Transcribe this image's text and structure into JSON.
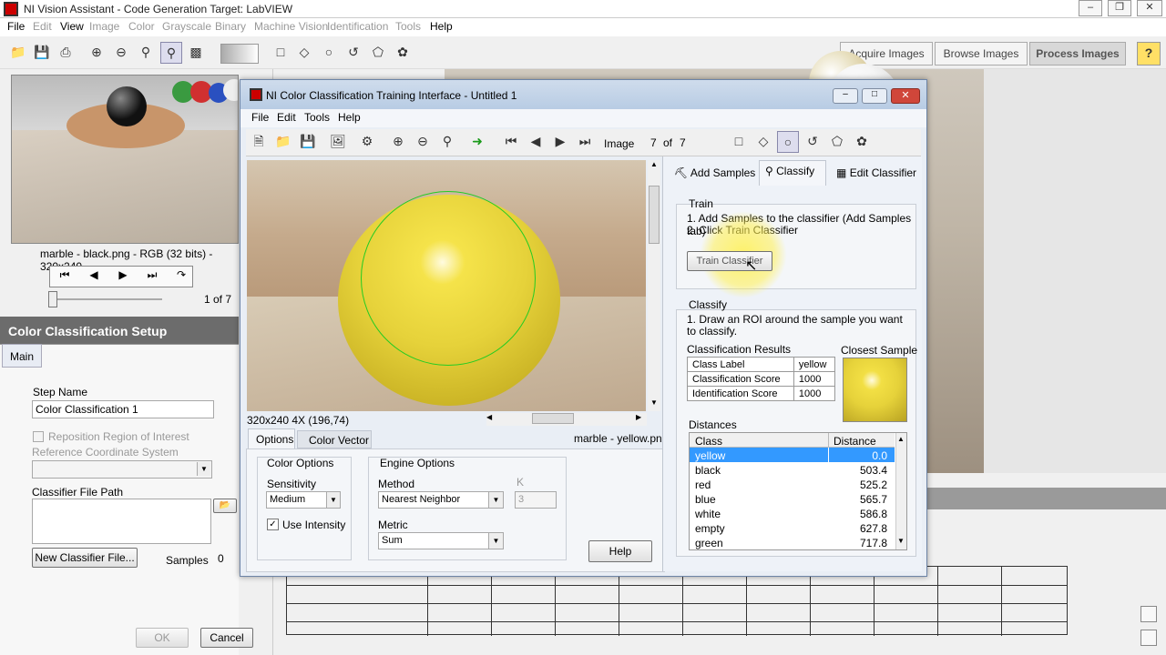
{
  "app": {
    "title": "NI Vision Assistant - Code Generation Target: LabVIEW",
    "menu": [
      "File",
      "Edit",
      "View",
      "Image",
      "Color",
      "Grayscale",
      "Binary",
      "Machine Vision",
      "Identification",
      "Tools",
      "Help"
    ],
    "menu_disabled": [
      false,
      true,
      false,
      true,
      true,
      true,
      true,
      true,
      true,
      true,
      false
    ],
    "mode_tabs": [
      "Acquire Images",
      "Browse Images",
      "Process Images"
    ],
    "help_icon": "?"
  },
  "browser": {
    "caption": "marble - black.png - RGB (32 bits) - 320x240",
    "page_text": "1 of 7"
  },
  "setup": {
    "header": "Color Classification Setup",
    "tab": "Main",
    "step_name_label": "Step Name",
    "step_name_value": "Color Classification 1",
    "reposition_label": "Reposition Region of Interest",
    "ref_coord_label": "Reference Coordinate System",
    "classifier_path_label": "Classifier File Path",
    "new_classifier_button": "New Classifier File...",
    "samples_label": "Samples",
    "samples_value": "0",
    "ok_button": "OK",
    "cancel_button": "Cancel"
  },
  "dialog": {
    "title": "NI Color Classification Training Interface - Untitled 1",
    "menu": [
      "File",
      "Edit",
      "Tools",
      "Help"
    ],
    "image_label": "Image",
    "image_index": "7",
    "image_of": "of",
    "image_total": "7",
    "status_left": "320x240 4X   (196,74)",
    "filename": "marble - yellow.png",
    "bottom_tabs": [
      "Options",
      "Color Vector"
    ],
    "color_options": {
      "title": "Color Options",
      "sensitivity_label": "Sensitivity",
      "sensitivity_value": "Medium",
      "use_intensity_label": "Use Intensity"
    },
    "engine_options": {
      "title": "Engine Options",
      "method_label": "Method",
      "method_value": "Nearest Neighbor",
      "k_label": "K",
      "k_value": "3",
      "metric_label": "Metric",
      "metric_value": "Sum"
    },
    "help_button": "Help",
    "right_tabs": [
      "Add Samples",
      "Classify",
      "Edit Classifier"
    ],
    "train": {
      "title": "Train",
      "step1": "1. Add Samples to the classifier (Add Samples tab)",
      "step2": "2. Click Train Classifier",
      "button": "Train Classifier"
    },
    "classify": {
      "title": "Classify",
      "step1": "1. Draw an ROI around the sample you want to classify.",
      "results_label": "Classification Results",
      "closest_label": "Closest Sample",
      "results": [
        {
          "key": "Class Label",
          "value": "yellow"
        },
        {
          "key": "Classification Score",
          "value": "1000"
        },
        {
          "key": "Identification Score",
          "value": "1000"
        }
      ],
      "distances_label": "Distances",
      "dist_headers": [
        "Class",
        "Distance"
      ],
      "distances": [
        {
          "cls": "yellow",
          "dist": "0.0"
        },
        {
          "cls": "black",
          "dist": "503.4"
        },
        {
          "cls": "red",
          "dist": "525.2"
        },
        {
          "cls": "blue",
          "dist": "565.7"
        },
        {
          "cls": "white",
          "dist": "586.8"
        },
        {
          "cls": "empty",
          "dist": "627.8"
        },
        {
          "cls": "green",
          "dist": "717.8"
        }
      ]
    }
  },
  "colors": {
    "selection": "#3399ff",
    "setup_header": "#6c6c6c",
    "marble": "#e6d23a",
    "roi": "#22cc22"
  }
}
